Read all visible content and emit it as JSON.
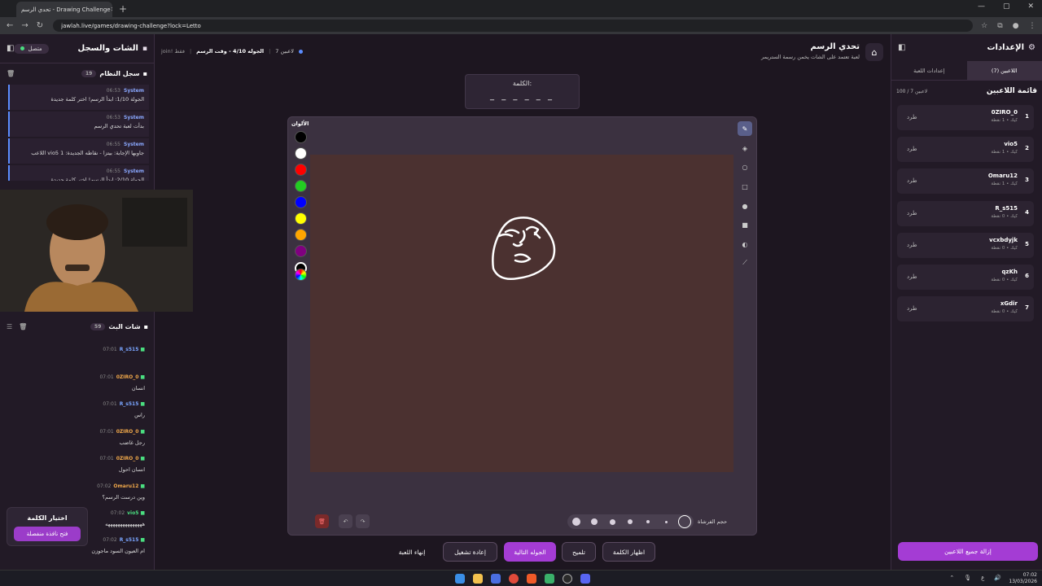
{
  "browser": {
    "tab_title": "تحدي الرسم - Drawing Challenge",
    "url": "jawlah.live/games/drawing-challenge?lock=Letto"
  },
  "header": {
    "title": "تحدي الرسم",
    "subtitle": "لعبة تعتمد على الشات يخمن رسمة الستريمر",
    "players_count": "7 لاعبين",
    "round": "الجوله 4/10 - وقت الرسم",
    "join_only": "join! فقط"
  },
  "word": {
    "label": "الكلمة:",
    "mask": "_ _ _ _ _ _"
  },
  "left_panel": {
    "title": "الشات والسجل",
    "status": "متصل",
    "system_log_title": "سجل النظام",
    "system_log_count": "19",
    "system_messages": [
      {
        "time": "06:53",
        "user": "System",
        "text": "الجولة 1/10: ابدأ الرسم! اختر كلمة جديدة"
      },
      {
        "time": "06:53",
        "user": "System",
        "text": "بدأت لعبة تحدي الرسم"
      },
      {
        "time": "06:55",
        "user": "System",
        "text": "اللاعب vio5 جاوبها الإجابة: بيتزا - نقاطه الجديدة: 1"
      },
      {
        "time": "06:55",
        "user": "System",
        "text": "الجولة 2/10: ابدأ الرسم! اختر كلمة جديدة"
      }
    ],
    "chat_title": "شات البث",
    "chat_count": "59",
    "chat_messages": [
      {
        "time": "07:01",
        "user": "R_s515",
        "text": "",
        "color": "blue"
      },
      {
        "time": "07:01",
        "user": "0ZIRO_0",
        "text": "انسان",
        "color": "orange"
      },
      {
        "time": "07:01",
        "user": "R_s515",
        "text": "راس",
        "color": "blue"
      },
      {
        "time": "07:01",
        "user": "0ZIRO_0",
        "text": "رجل غاضب",
        "color": "orange"
      },
      {
        "time": "07:01",
        "user": "0ZIRO_0",
        "text": "انسان احول",
        "color": "orange"
      },
      {
        "time": "07:02",
        "user": "Omaru12",
        "text": "وين درست الرسم؟",
        "color": "orange"
      },
      {
        "time": "07:02",
        "user": "vio5",
        "text": "هههههههههههههههه",
        "color": "green"
      },
      {
        "time": "07:02",
        "user": "R_s515",
        "text": "ام العيون السود ماجوزن",
        "color": "blue"
      }
    ],
    "pick_word": {
      "title": "اختيار الكلمة",
      "button": "فتح نافذة منفصلة"
    }
  },
  "canvas": {
    "colors_title": "الألوان",
    "colors": [
      "#000000",
      "#ffffff",
      "#ff0000",
      "#22cc22",
      "#0000ff",
      "#ffff00",
      "#ffa500",
      "#800080"
    ],
    "brush_label": "حجم الفرشاة",
    "bg_color": "#4b3130"
  },
  "actions": {
    "end_game": "إنهاء اللعبة",
    "restart": "إعادة تشغيل",
    "next_round": "الجوله التالية",
    "hint": "تلميح",
    "reveal": "اظهار الكلمة"
  },
  "right_panel": {
    "title": "الإعدادات",
    "tab_players": "اللاعبين (7)",
    "tab_settings": "إعدادات اللعبة",
    "list_title": "قائمة اللاعبين",
    "capacity": "100 / 7 لاعبين",
    "kick_label": "طرد",
    "players": [
      {
        "rank": "1",
        "name": "0ZIRO_0",
        "points": "كيك • 1 نقطة"
      },
      {
        "rank": "2",
        "name": "vio5",
        "points": "كيك • 1 نقطة"
      },
      {
        "rank": "3",
        "name": "Omaru12",
        "points": "كيك • 1 نقطة"
      },
      {
        "rank": "4",
        "name": "R_s515",
        "points": "كيك • 0 نقطة"
      },
      {
        "rank": "5",
        "name": "vcxbdyjk",
        "points": "كيك • 0 نقطة"
      },
      {
        "rank": "6",
        "name": "qzKh",
        "points": "كيك • 0 نقطة"
      },
      {
        "rank": "7",
        "name": "xGdir",
        "points": "كيك • 0 نقطة"
      }
    ],
    "remove_all": "إزالة جميع اللاعبين"
  },
  "taskbar": {
    "time": "07:02",
    "date": "13/03/2026"
  }
}
